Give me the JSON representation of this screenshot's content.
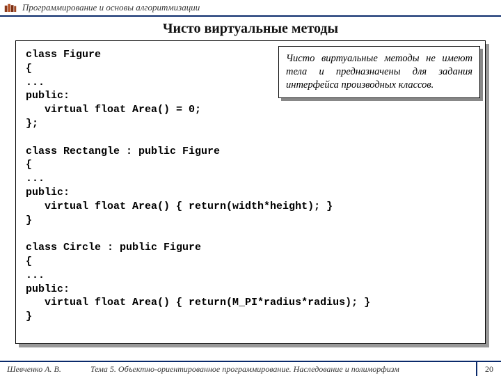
{
  "header": {
    "course_title": "Программирование и основы алгоритмизации"
  },
  "slide": {
    "title": "Чисто виртуальные методы"
  },
  "code": {
    "text": "class Figure\n{\n...\npublic:\n   virtual float Area() = 0;\n};\n\nclass Rectangle : public Figure\n{\n...\npublic:\n   virtual float Area() { return(width*height); }\n}\n\nclass Circle : public Figure\n{\n...\npublic:\n   virtual float Area() { return(M_PI*radius*radius); }\n}"
  },
  "note": {
    "text": "Чисто виртуальные методы не имеют тела и предназначены для задания интерфейса производных классов."
  },
  "footer": {
    "author": "Шевченко А. В.",
    "topic": "Тема 5. Объектно-ориентированное программирование. Наследование и полиморфизм",
    "page": "20"
  }
}
